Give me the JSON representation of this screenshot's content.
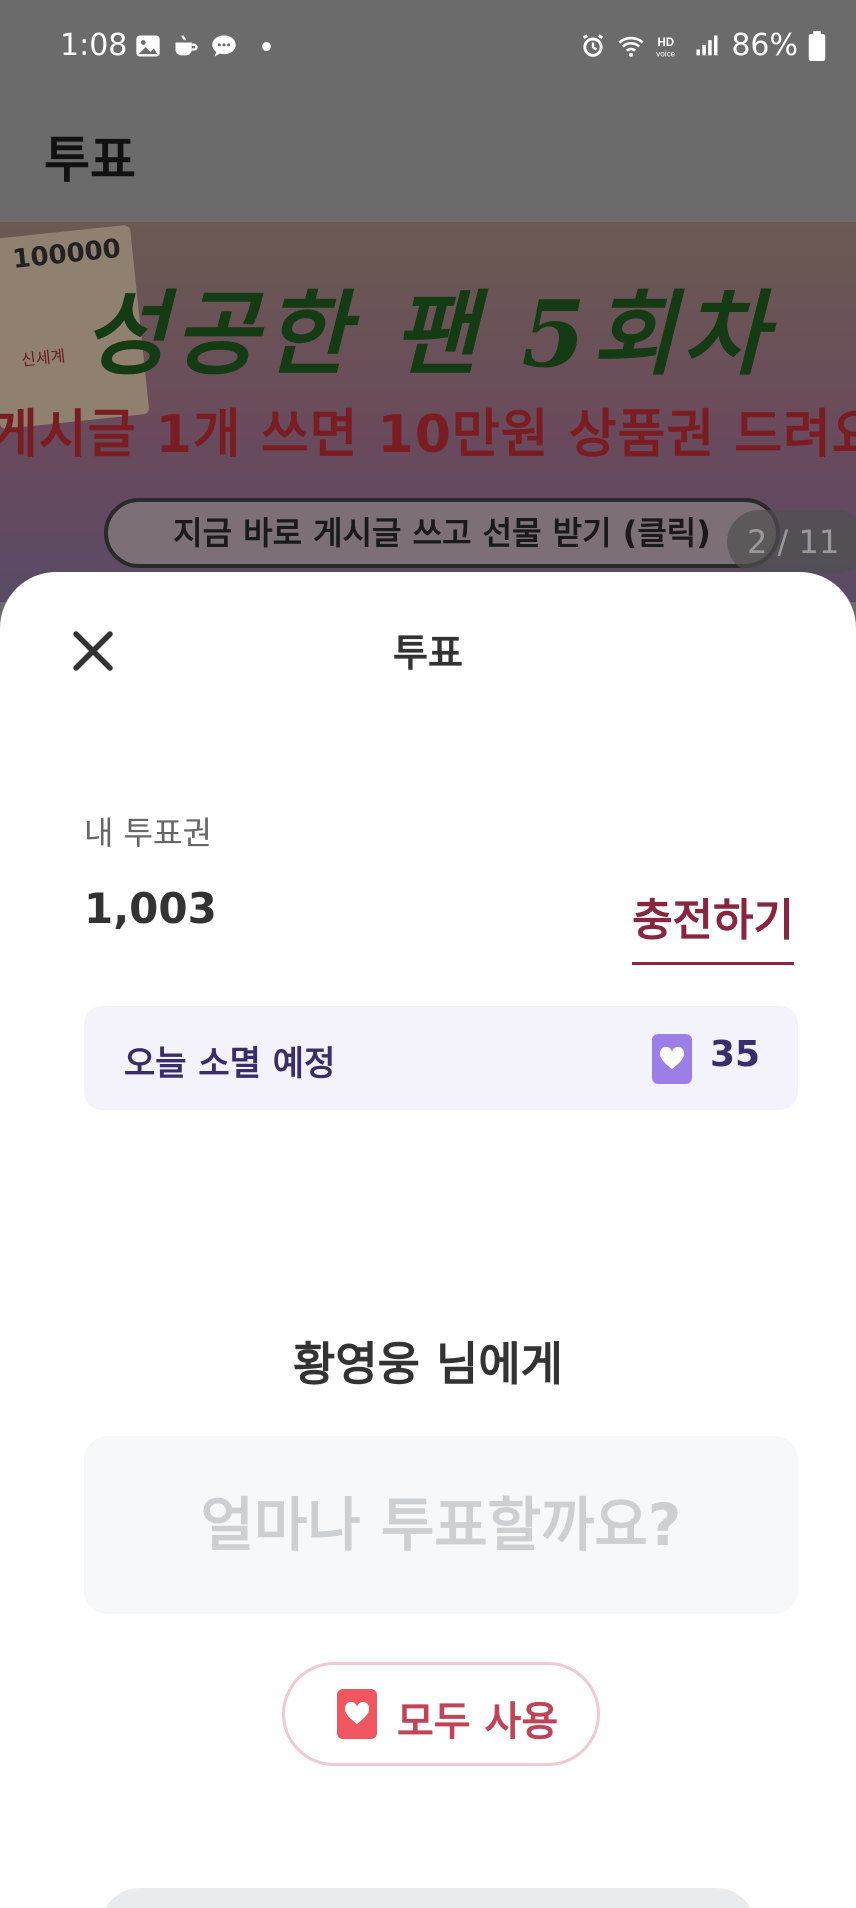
{
  "status_bar": {
    "time": "1:08",
    "battery": "86%",
    "icons_left": [
      "gallery-icon",
      "cafe-icon",
      "message-icon",
      "dot"
    ],
    "icons_right": [
      "alarm-icon",
      "wifi-icon",
      "hd-voice-icon",
      "signal-icon",
      "battery-icon"
    ]
  },
  "header": {
    "title": "투표"
  },
  "banner": {
    "voucher_amount": "100000",
    "voucher_label": "신세계",
    "headline": "성공한 팬 5회차",
    "subline": "게시글 1개 쓰면 10만원 상품권 드려요",
    "cta": "지금 바로 게시글 쓰고 선물 받기 (클릭)",
    "counter": "2 / 11"
  },
  "sheet": {
    "title": "투표",
    "balance_label": "내 투표권",
    "balance_value": "1,003",
    "charge_label": "충전하기",
    "expire_label": "오늘 소멸 예정",
    "expire_count": "35",
    "recipient": "황영웅 님에게",
    "vote_placeholder": "얼마나 투표할까요?",
    "use_all_label": "모두 사용"
  },
  "colors": {
    "accent": "#8a2540",
    "expire_heart": "#9b7fe6",
    "use_all_heart": "#f0565f",
    "use_all_text": "#c04356"
  }
}
